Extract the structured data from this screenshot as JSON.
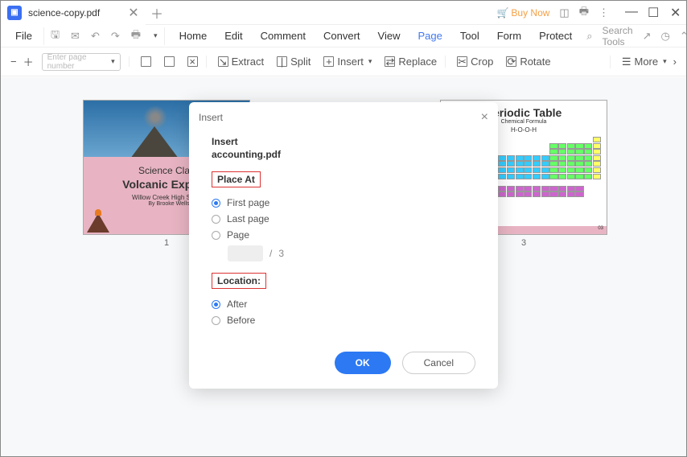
{
  "titlebar": {
    "tab_title": "science-copy.pdf",
    "buy_now": "Buy Now"
  },
  "menubar": {
    "file": "File",
    "items": [
      "Home",
      "Edit",
      "Comment",
      "Convert",
      "View",
      "Page",
      "Tool",
      "Form",
      "Protect"
    ],
    "search_placeholder": "Search Tools"
  },
  "toolbar": {
    "page_placeholder": "Enter page number",
    "extract": "Extract",
    "split": "Split",
    "insert": "Insert",
    "replace": "Replace",
    "crop": "Crop",
    "rotate": "Rotate",
    "more": "More"
  },
  "thumbs": {
    "p1": "1",
    "p3": "3",
    "page1": {
      "line1": "Science Class",
      "line2": "Volcanic Experim",
      "line3": "Willow Creek High School",
      "line4": "By Brooke Wells"
    },
    "page3": {
      "title": "Periodic Table",
      "sub": "Chemical Formula",
      "form": "H-O-O-H",
      "num": "03"
    }
  },
  "dialog": {
    "title": "Insert",
    "insert_label": "Insert",
    "filename": "accounting.pdf",
    "placeat": "Place At",
    "opt_first": "First page",
    "opt_last": "Last page",
    "opt_page": "Page",
    "total": "3",
    "location": "Location:",
    "opt_after": "After",
    "opt_before": "Before",
    "ok": "OK",
    "cancel": "Cancel"
  }
}
